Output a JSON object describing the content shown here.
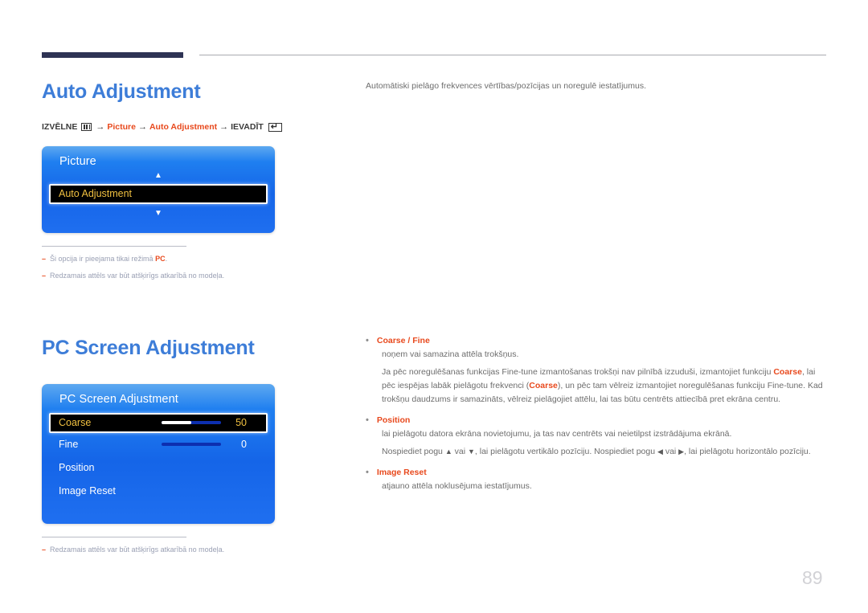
{
  "page": {
    "number": "89",
    "accent_blue": "#3d7dd8",
    "accent_red": "#e8491d",
    "osd_highlight_yellow": "#f0c040",
    "rule_navy": "#2e3354"
  },
  "sections": [
    {
      "id": "auto-adjustment",
      "title": "Auto Adjustment",
      "menu_path": {
        "prefix_label": "IZVĒLNE",
        "menu_icon": "menu-icon",
        "arrow": "→",
        "steps": [
          "Picture",
          "Auto Adjustment"
        ],
        "suffix_label": "IEVADĪT",
        "enter_icon": "enter-key-icon"
      },
      "osd": {
        "title": "Picture",
        "chevron_up_icon": "chevron-up-icon",
        "chevron_down_icon": "chevron-down-icon",
        "selected_row": {
          "label": "Auto Adjustment"
        }
      },
      "notes": [
        {
          "text_before": "Ši opcija ir pieejama tikai režimā ",
          "highlight": "PC",
          "text_after": "."
        },
        {
          "text_before": "Redzamais attēls var būt atšķirīgs atkarībā no modeļa.",
          "highlight": "",
          "text_after": ""
        }
      ],
      "description": "Automātiski pielāgo frekvences vērtības/pozīcijas un noregulē iestatījumus."
    },
    {
      "id": "pc-screen-adjustment",
      "title": "PC Screen Adjustment",
      "osd": {
        "title": "PC Screen Adjustment",
        "rows": [
          {
            "label": "Coarse",
            "value": "50",
            "has_slider": true,
            "fill_percent": 50,
            "selected": true
          },
          {
            "label": "Fine",
            "value": "0",
            "has_slider": true,
            "fill_percent": 0,
            "selected": false
          },
          {
            "label": "Position",
            "value": "",
            "has_slider": false,
            "fill_percent": 0,
            "selected": false
          },
          {
            "label": "Image Reset",
            "value": "",
            "has_slider": false,
            "fill_percent": 0,
            "selected": false
          }
        ]
      },
      "notes": [
        {
          "text_before": "Redzamais attēls var būt atšķirīgs atkarībā no modeļa.",
          "highlight": "",
          "text_after": ""
        }
      ]
    }
  ],
  "bullets": [
    {
      "heading_parts": [
        "Coarse",
        " / ",
        "Fine"
      ],
      "heading_plain": "Coarse / Fine",
      "paragraphs": [
        "noņem vai samazina attēla trokšņus.",
        "Ja pēc noregulēšanas funkcijas Fine-tune izmantošanas trokšņi nav pilnībā izzuduši, izmantojiet funkciju Coarse, lai pēc iespējas labāk pielāgotu frekvenci (Coarse), un pēc tam vēlreiz izmantojiet noregulēšanas funkciju Fine-tune. Kad trokšņu daudzums ir samazināts, vēlreiz pielāgojiet attēlu, lai tas būtu centrēts attiecībā pret ekrāna centru."
      ]
    },
    {
      "heading_parts": [
        "Position"
      ],
      "heading_plain": "Position",
      "paragraphs": [
        "lai pielāgotu datora ekrāna novietojumu, ja tas nav centrēts vai neietilpst izstrādājuma ekrānā.",
        "Nospiediet pogu ▲ vai ▼, lai pielāgotu vertikālo pozīciju. Nospiediet pogu ◀ vai ▶, lai pielāgotu horizontālo pozīciju."
      ]
    },
    {
      "heading_parts": [
        "Image Reset"
      ],
      "heading_plain": "Image Reset",
      "paragraphs": [
        "atjauno attēla noklusējuma iestatījumus."
      ]
    }
  ]
}
